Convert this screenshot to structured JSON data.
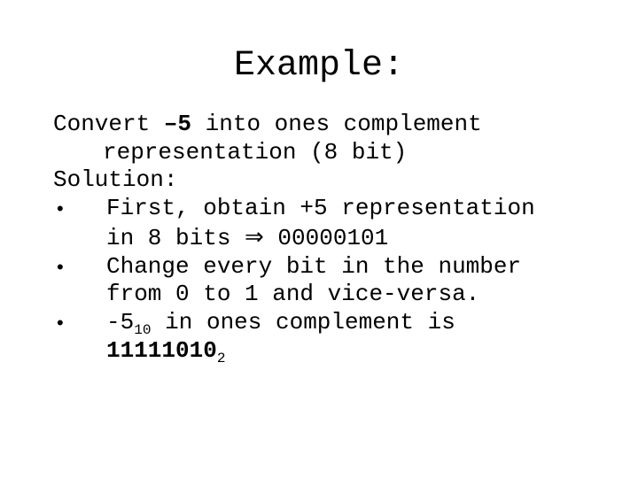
{
  "title": "Example:",
  "intro": {
    "line1_pre": "Convert ",
    "line1_bold": "–5",
    "line1_post": " into ones complement",
    "line2": "representation (8 bit)"
  },
  "solution_label": "Solution:",
  "bullets": [
    {
      "line1_a": "First, obtain +5 representation",
      "line2_a": "in 8 bits ",
      "arrow": "⇒",
      "line2_b": " 00000101"
    },
    {
      "line1_a": "Change every bit in the number",
      "line2_a": "from 0 to 1 and vice-versa."
    },
    {
      "line1_pre": "-5",
      "line1_sub": "10",
      "line1_post": " in ones complement is",
      "line2_bold": "11111010",
      "line2_sub": "2"
    }
  ]
}
